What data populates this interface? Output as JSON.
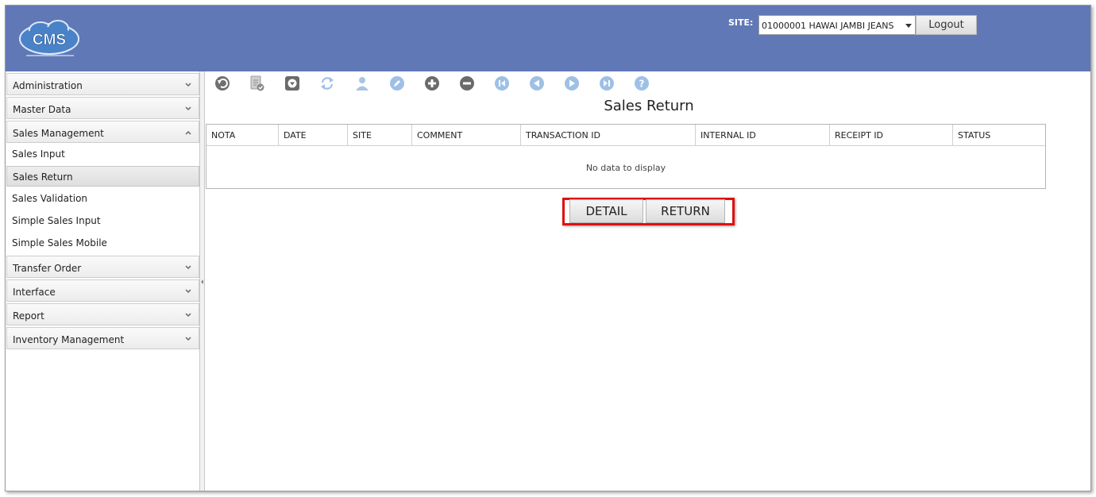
{
  "header": {
    "logo_text": "CMS",
    "site_label": "SITE:",
    "site_value": "01000001 HAWAI JAMBI JEANS",
    "logout_label": "Logout"
  },
  "sidebar": {
    "groups": [
      {
        "label": "Administration"
      },
      {
        "label": "Master Data"
      },
      {
        "label": "Sales Management"
      },
      {
        "label": "Transfer Order"
      },
      {
        "label": "Interface"
      },
      {
        "label": "Report"
      },
      {
        "label": "Inventory Management"
      }
    ],
    "sales_items": [
      {
        "label": "Sales Input"
      },
      {
        "label": "Sales Return"
      },
      {
        "label": "Sales Validation"
      },
      {
        "label": "Simple Sales Input"
      },
      {
        "label": "Simple Sales Mobile"
      }
    ]
  },
  "toolbar": {
    "icons": [
      "undo-icon",
      "approve-document-icon",
      "download-icon",
      "refresh-icon",
      "user-icon",
      "edit-icon",
      "add-icon",
      "remove-icon",
      "first-page-icon",
      "previous-icon",
      "next-icon",
      "last-page-icon",
      "help-icon"
    ]
  },
  "main": {
    "title": "Sales Return",
    "columns": [
      "NOTA",
      "DATE",
      "SITE",
      "COMMENT",
      "TRANSACTION ID",
      "INTERNAL ID",
      "RECEIPT ID",
      "STATUS"
    ],
    "empty_text": "No data to display",
    "detail_label": "DETAIL",
    "return_label": "RETURN"
  },
  "colors": {
    "header_bg": "#6078b6",
    "highlight": "#e01010",
    "icon_active": "#6f6f6f",
    "icon_blue": "#8fb4dd"
  }
}
